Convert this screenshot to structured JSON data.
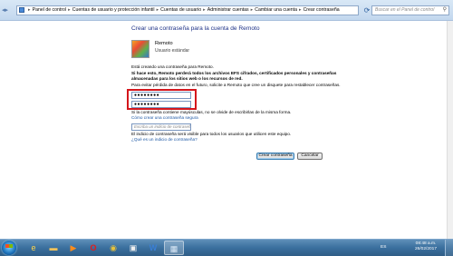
{
  "address_bar": {
    "crumbs": [
      "Panel de control",
      "Cuentas de usuario y protección infantil",
      "Cuentas de usuario",
      "Administrar cuentas",
      "Cambiar una cuenta",
      "Crear contraseña"
    ],
    "search_placeholder": "Buscar en el Panel de control"
  },
  "main": {
    "heading": "Crear una contraseña para la cuenta de Remoto",
    "user_name": "Remoto",
    "user_type": "Usuario estándar",
    "intro": "Está creando una contraseña para Remoto.",
    "warning_line1": "Si hace esto, Remoto perderá todos los archivos EFS cifrados, certificados personales y contraseñas",
    "warning_line2": "almacenadas para los sitios web o los recursos de red.",
    "advice": "Para evitar pérdida de datos en el futuro, solicite a Remoto que cree un disquete para restablecer contraseñas.",
    "new_password": "●●●●●●●●",
    "confirm_password": "●●●●●●●●",
    "caps_note": "Si la contraseña contiene mayúsculas, no se olvide de escribirlas de la misma forma.",
    "secure_link": "Cómo crear una contraseña segura",
    "hint_placeholder": "Escriba un indicio de contraseña",
    "hint_note": "El indicio de contraseña será visible para todos los usuarios que utilicen este equipo.",
    "hint_link": "¿Qué es un indicio de contraseña?",
    "create_button": "Crear contraseña",
    "cancel_button": "Cancelar"
  },
  "taskbar": {
    "apps": [
      "ie-icon",
      "explorer-icon",
      "media-player-icon",
      "opera-icon",
      "chrome-icon",
      "paint-icon",
      "word-icon",
      "control-panel-icon"
    ],
    "language": "ES",
    "time": "08:48 a.m.",
    "date": "26/02/2017"
  }
}
